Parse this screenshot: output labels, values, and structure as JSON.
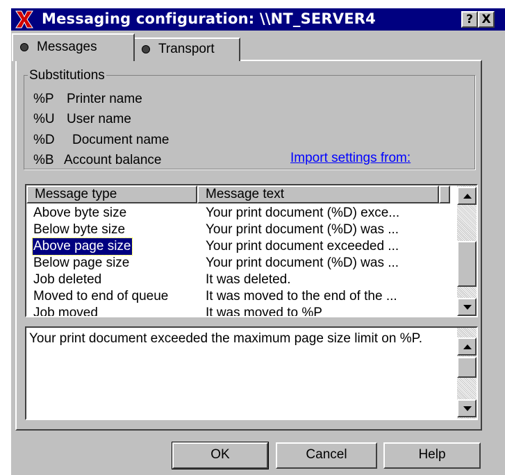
{
  "window": {
    "title": "Messaging configuration: \\\\NT_SERVER4",
    "help_button": "?",
    "close_button": "X"
  },
  "tabs": [
    {
      "label": "Messages",
      "active": true
    },
    {
      "label": "Transport",
      "active": false
    }
  ],
  "substitutions": {
    "legend": "Substitutions",
    "items": [
      {
        "code": "%P",
        "label": "Printer name"
      },
      {
        "code": "%U",
        "label": "User name"
      },
      {
        "code": "%D",
        "label": "Document name"
      },
      {
        "code": "%B",
        "label": "Account balance"
      }
    ],
    "import_link": "Import settings from:"
  },
  "message_list": {
    "columns": [
      "Message type",
      "Message text"
    ],
    "rows": [
      {
        "type": "Above byte size",
        "text": "Your print document (%D) exce..."
      },
      {
        "type": "Below byte size",
        "text": "Your print document (%D) was ..."
      },
      {
        "type": "Above page size",
        "text": "Your print document exceeded ...",
        "selected": true
      },
      {
        "type": "Below page size",
        "text": "Your print document (%D) was ..."
      },
      {
        "type": "Job deleted",
        "text": "It was deleted."
      },
      {
        "type": "Moved to end of queue",
        "text": "It was moved to the end of the ..."
      },
      {
        "type": "Job moved",
        "text": "It was moved to %P"
      }
    ],
    "selected_index": 2
  },
  "message_editor": {
    "value": "Your print document exceeded the maximum page size limit on %P."
  },
  "buttons": {
    "ok": "OK",
    "cancel": "Cancel",
    "help": "Help"
  },
  "colors": {
    "title_bar": "#000080",
    "face": "#c0c0c0",
    "selection": "#000080",
    "link": "#0000ff",
    "app_icon": "#d00000"
  }
}
